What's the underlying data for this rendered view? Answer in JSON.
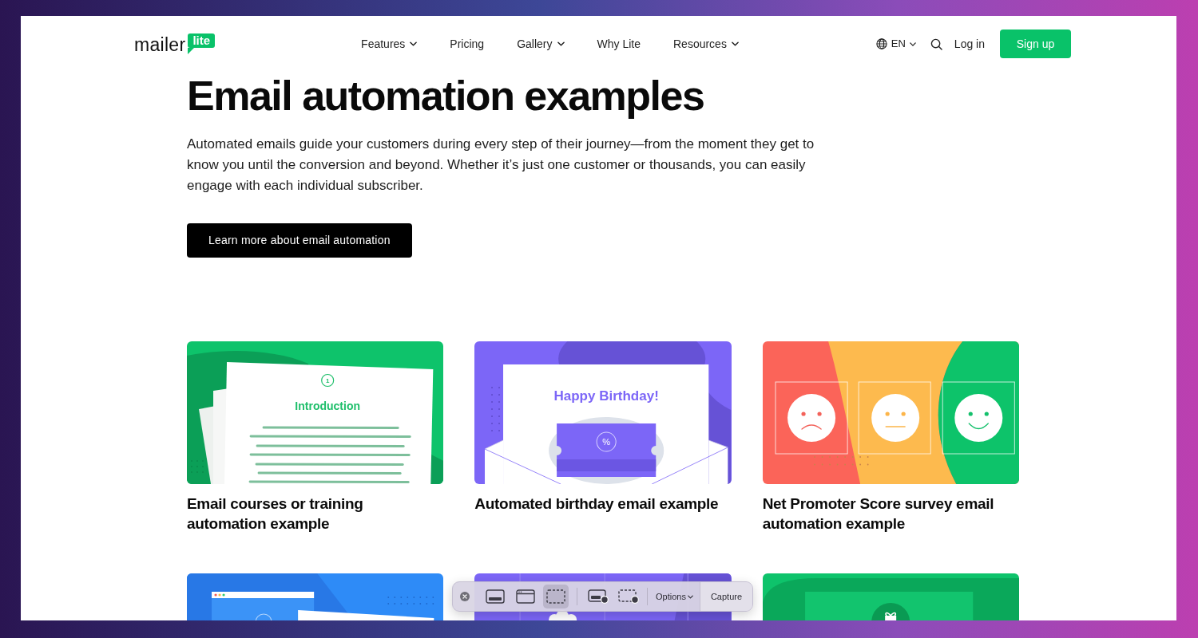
{
  "header": {
    "logo": {
      "wordmark": "mailer",
      "badge": "lite"
    },
    "nav": [
      {
        "label": "Features",
        "menu": true
      },
      {
        "label": "Pricing",
        "menu": false
      },
      {
        "label": "Gallery",
        "menu": true
      },
      {
        "label": "Why Lite",
        "menu": false
      },
      {
        "label": "Resources",
        "menu": true
      }
    ],
    "language": "EN",
    "login": "Log in",
    "signup": "Sign up"
  },
  "hero": {
    "title": "Email automation examples",
    "text": "Automated emails guide your customers during every step of their journey—from the moment they get to know you until the conversion and beyond. Whether it’s just one customer or thousands, you can easily engage with each individual subscriber.",
    "button": "Learn more about email automation"
  },
  "cards": [
    {
      "kind": "course",
      "title": "Email courses or training automation example",
      "illustration": {
        "step": "1",
        "heading": "Introduction"
      }
    },
    {
      "kind": "birthday",
      "title": "Automated birthday email example",
      "illustration": {
        "heading": "Happy Birthday!",
        "symbol": "%"
      }
    },
    {
      "kind": "nps",
      "title": "Net Promoter Score survey email automation example"
    },
    {
      "kind": "browser"
    },
    {
      "kind": "cloud"
    },
    {
      "kind": "gift"
    }
  ],
  "capture_toolbar": {
    "tools": [
      {
        "kind": "screen",
        "selected": false
      },
      {
        "kind": "window",
        "selected": false
      },
      {
        "kind": "selection",
        "selected": true
      },
      {
        "kind": "record-screen",
        "selected": false
      },
      {
        "kind": "record-selection",
        "selected": false
      }
    ],
    "options": "Options",
    "capture": "Capture"
  }
}
